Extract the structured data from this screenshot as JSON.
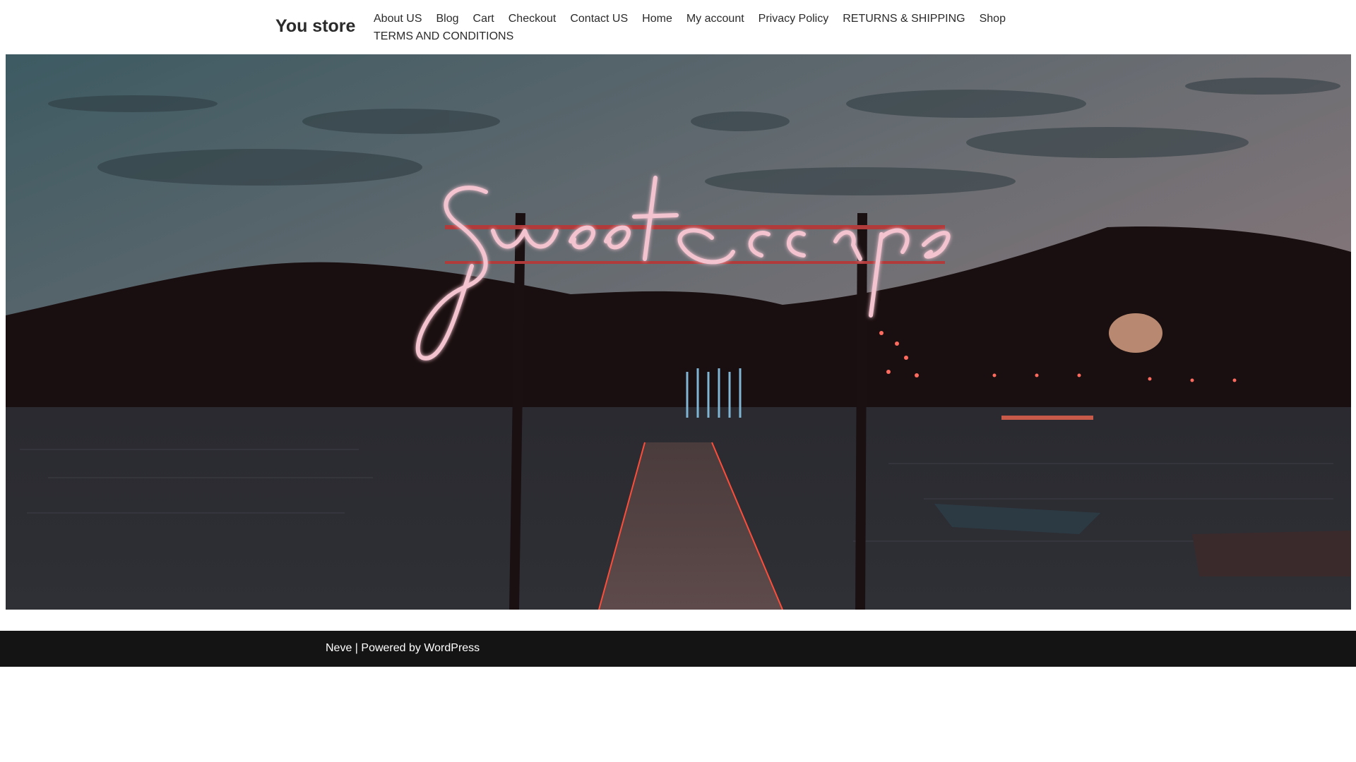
{
  "header": {
    "site_title": "You store",
    "nav_items": [
      "About US",
      "Blog",
      "Cart",
      "Checkout",
      "Contact US",
      "Home",
      "My account",
      "Privacy Policy",
      "RETURNS & SHIPPING",
      "Shop",
      "TERMS AND CONDITIONS"
    ]
  },
  "hero": {
    "image": "neon-sign-pier-at-dusk",
    "sign_text": "Sweet escape"
  },
  "footer": {
    "theme_link": "Neve",
    "separator": " | Powered by ",
    "platform_link": "WordPress"
  },
  "colors": {
    "text": "#2b2b2b",
    "footer_bg": "#141414",
    "neon": "#f4c3d0"
  }
}
